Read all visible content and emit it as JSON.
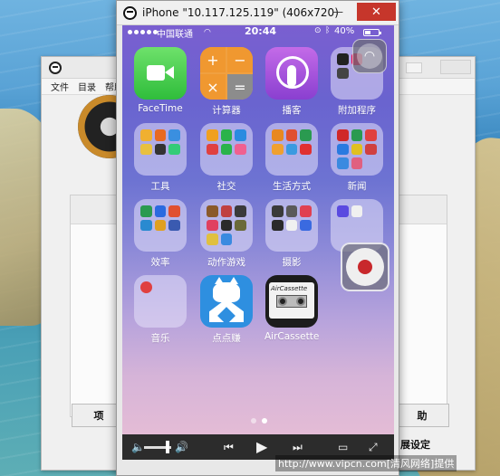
{
  "background_window": {
    "menu": [
      "文件",
      "目录",
      "帮助"
    ],
    "button_left_label": "项",
    "button_right_label": "助",
    "settings_text": "展设定"
  },
  "mirror_window": {
    "title": "iPhone \"10.117.125.119\" (406x720)",
    "minimize_glyph": "—",
    "close_glyph": "✕"
  },
  "status_bar": {
    "carrier": "中国联通",
    "time": "20:44",
    "battery": "40%"
  },
  "apps": [
    {
      "label": "FaceTime",
      "icon": "facetime-icon"
    },
    {
      "label": "计算器",
      "icon": "calculator-icon"
    },
    {
      "label": "播客",
      "icon": "podcasts-icon"
    },
    {
      "label": "附加程序",
      "icon": "folder-icon"
    },
    {
      "label": "工具",
      "icon": "folder-icon"
    },
    {
      "label": "社交",
      "icon": "folder-icon"
    },
    {
      "label": "生活方式",
      "icon": "folder-icon"
    },
    {
      "label": "新闻",
      "icon": "folder-icon"
    },
    {
      "label": "效率",
      "icon": "folder-icon"
    },
    {
      "label": "动作游戏",
      "icon": "folder-icon"
    },
    {
      "label": "摄影",
      "icon": "folder-icon"
    },
    {
      "label": "",
      "icon": "folder-icon"
    },
    {
      "label": "音乐",
      "icon": "folder-icon"
    },
    {
      "label": "点点赚",
      "icon": "dianzan-icon"
    },
    {
      "label": "AirCassette",
      "icon": "aircassette-icon"
    }
  ],
  "calculator_keys": [
    "+",
    "−",
    "×",
    "="
  ],
  "aircassette_tape_text": "AirCassette",
  "pages": {
    "count": 2,
    "active_index": 1
  },
  "controls": {
    "volume_low": "🔈",
    "volume_high": "🔊",
    "volume_level": 0.85,
    "prev": "⏮",
    "play": "▶",
    "next": "⏭",
    "screen": "▭",
    "fullscreen": "⤢"
  },
  "watermark": "http://www.vipcn.com[清风网络]提供",
  "colors": {
    "close_button": "#c6362b",
    "record_dot": "#c8282c"
  }
}
